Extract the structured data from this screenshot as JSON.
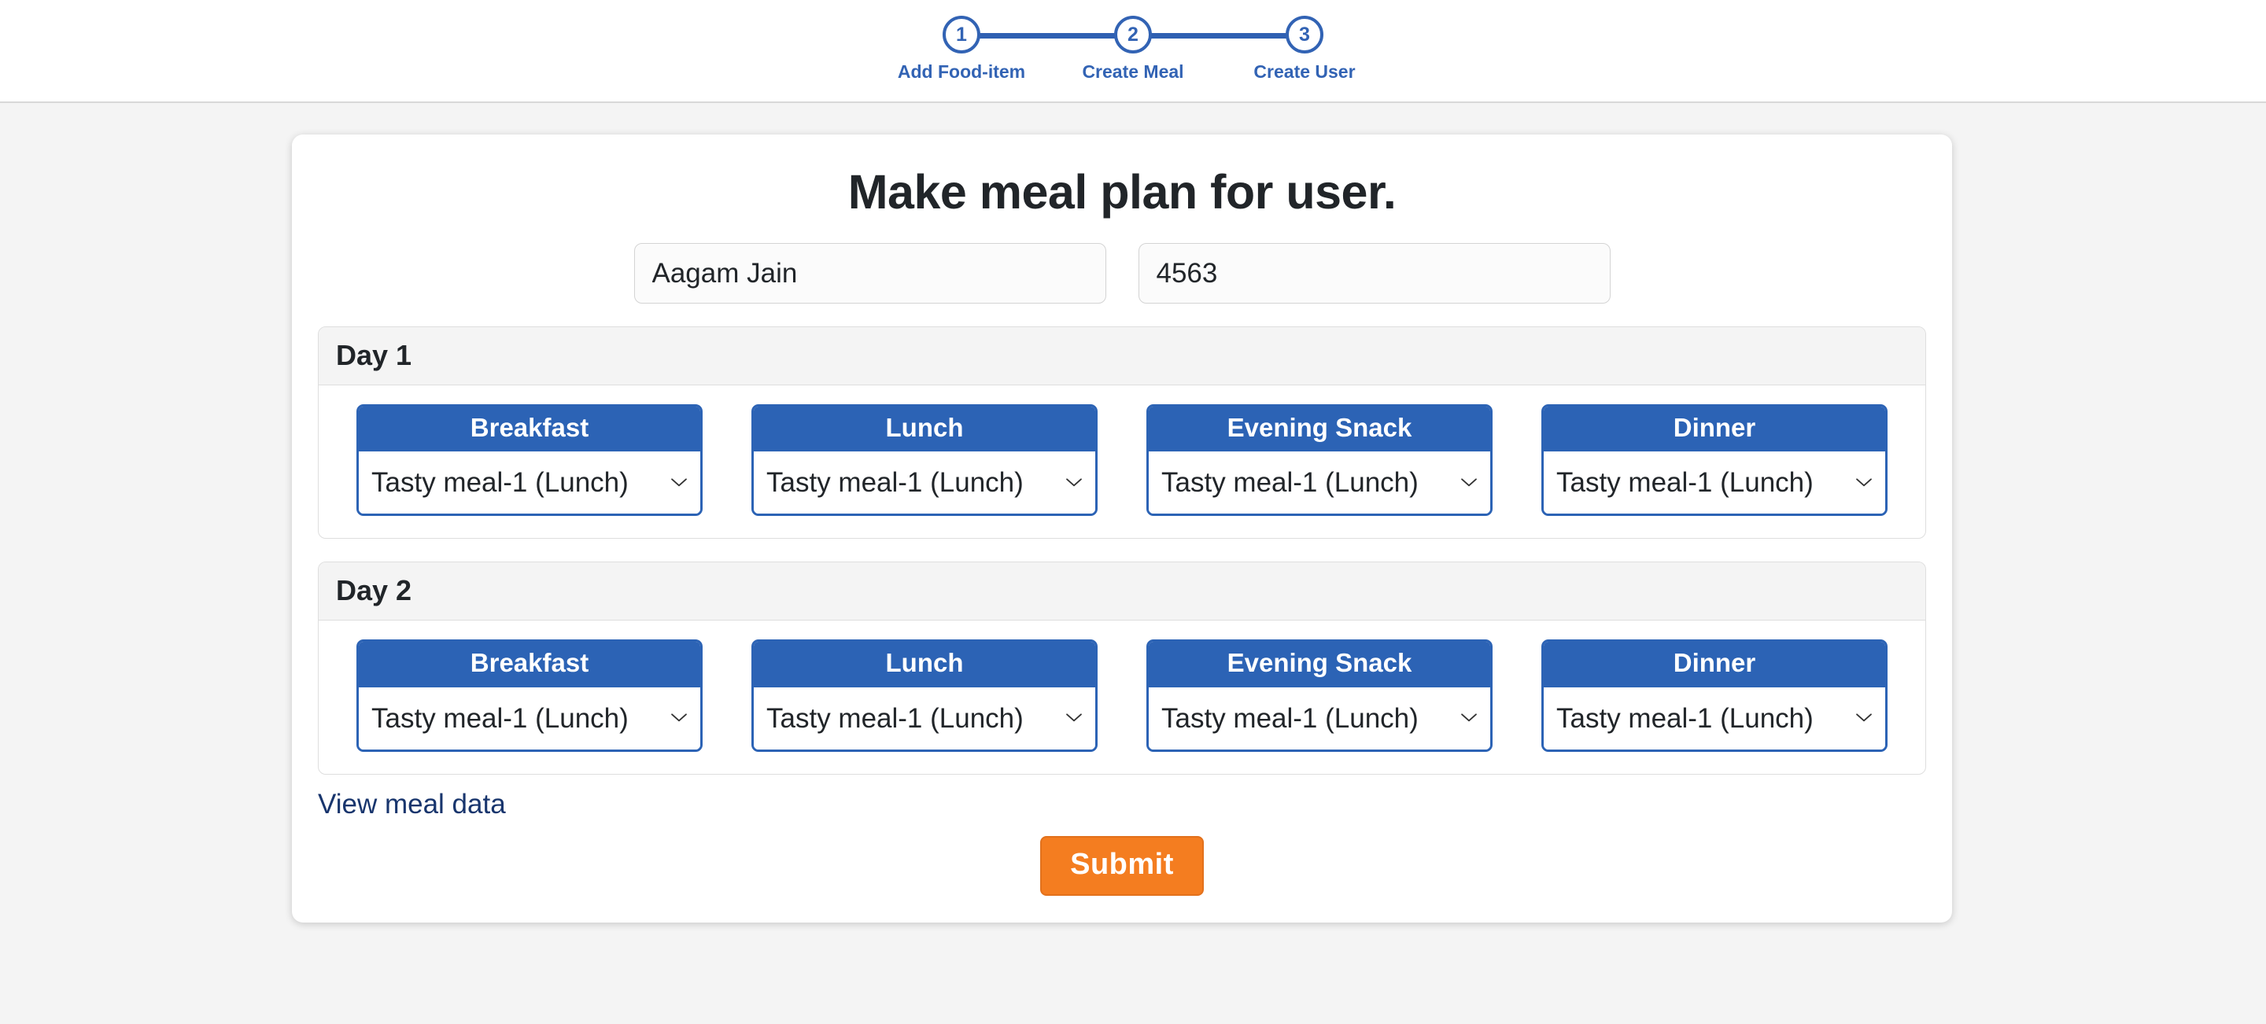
{
  "stepper": {
    "steps": [
      {
        "number": "1",
        "label": "Add Food-item"
      },
      {
        "number": "2",
        "label": "Create Meal"
      },
      {
        "number": "3",
        "label": "Create User"
      }
    ],
    "accent_color": "#3263b4"
  },
  "card": {
    "title": "Make meal plan for user.",
    "fields": {
      "user_name": {
        "value": "Aagam Jain",
        "placeholder": "Enter name"
      },
      "user_id": {
        "value": "4563",
        "placeholder": "Enter id"
      }
    },
    "days": [
      {
        "title": "Day 1",
        "meals": [
          {
            "label": "Breakfast",
            "selected": "Tasty meal-1 (Lunch)"
          },
          {
            "label": "Lunch",
            "selected": "Tasty meal-1 (Lunch)"
          },
          {
            "label": "Evening Snack",
            "selected": "Tasty meal-1 (Lunch)"
          },
          {
            "label": "Dinner",
            "selected": "Tasty meal-1 (Lunch)"
          }
        ]
      },
      {
        "title": "Day 2",
        "meals": [
          {
            "label": "Breakfast",
            "selected": "Tasty meal-1 (Lunch)"
          },
          {
            "label": "Lunch",
            "selected": "Tasty meal-1 (Lunch)"
          },
          {
            "label": "Evening Snack",
            "selected": "Tasty meal-1 (Lunch)"
          },
          {
            "label": "Dinner",
            "selected": "Tasty meal-1 (Lunch)"
          }
        ]
      }
    ],
    "view_link": "View meal data",
    "submit_label": "Submit",
    "header_color": "#2c63b5",
    "submit_color": "#f47d20",
    "link_color": "#18356d"
  }
}
